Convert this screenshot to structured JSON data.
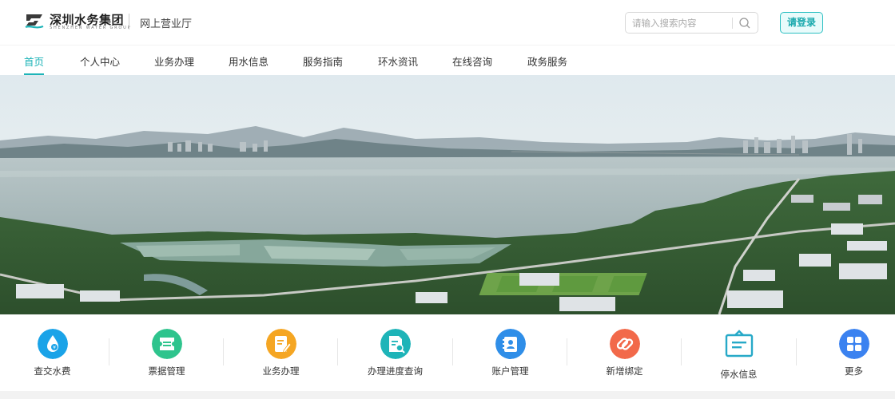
{
  "header": {
    "logo_name": "深圳水务集团",
    "logo_subtitle": "SHENZHEN WATER GROUP",
    "hall_name": "网上营业厅",
    "search_placeholder": "请输入搜索内容",
    "login_label": "请登录"
  },
  "nav": {
    "items": [
      {
        "label": "首页",
        "active": true
      },
      {
        "label": "个人中心"
      },
      {
        "label": "业务办理"
      },
      {
        "label": "用水信息"
      },
      {
        "label": "服务指南"
      },
      {
        "label": "环水资讯"
      },
      {
        "label": "在线咨询"
      },
      {
        "label": "政务服务"
      }
    ]
  },
  "services": {
    "items": [
      {
        "label": "查交水费",
        "icon": "water-bill-icon",
        "color": "#1aa3e8"
      },
      {
        "label": "票据管理",
        "icon": "invoice-icon",
        "color": "#2ec48d"
      },
      {
        "label": "业务办理",
        "icon": "business-edit-icon",
        "color": "#f5a623"
      },
      {
        "label": "办理进度查询",
        "icon": "progress-search-icon",
        "color": "#1eb4b8"
      },
      {
        "label": "账户管理",
        "icon": "account-icon",
        "color": "#2f8ee8"
      },
      {
        "label": "新增绑定",
        "icon": "link-icon",
        "color": "#f2694a"
      },
      {
        "label": "停水信息",
        "icon": "notice-board-icon",
        "color": "#27a9c8"
      },
      {
        "label": "更多",
        "icon": "more-grid-icon",
        "color": "#3b82f0"
      }
    ]
  },
  "colors": {
    "accent": "#1eb4b8",
    "login_border": "#2bbfc2"
  }
}
